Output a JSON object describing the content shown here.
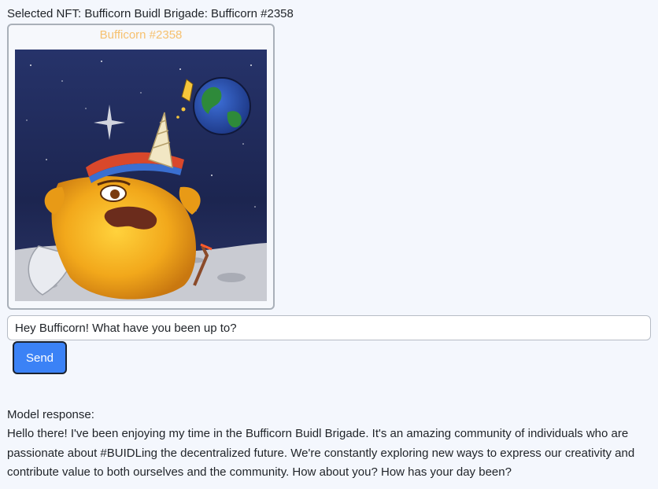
{
  "header": {
    "selected_prefix": "Selected NFT:",
    "selected_value": "Bufficorn Buidl Brigade: Bufficorn #2358"
  },
  "nft": {
    "name": "Bufficorn #2358",
    "image_alt": "Bufficorn #2358"
  },
  "chat": {
    "input_value": "Hey Bufficorn! What have you been up to?",
    "send_label": "Send"
  },
  "response": {
    "label": "Model response:",
    "text": "Hello there! I've been enjoying my time in the Bufficorn Buidl Brigade. It's an amazing community of individuals who are passionate about #BUIDLing the decentralized future. We're constantly exploring new ways to express our creativity and contribute value to both ourselves and the community. How about you? How has your day been?"
  },
  "colors": {
    "page_bg": "#f4f7fd",
    "card_border": "#a9b0b9",
    "nft_name": "#f6c16f",
    "button_bg": "#3b82f6",
    "button_border": "#1b2330"
  }
}
